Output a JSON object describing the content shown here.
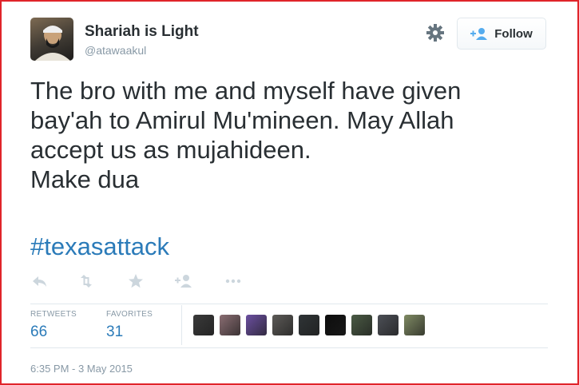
{
  "user": {
    "display_name": "Shariah is Light",
    "handle": "@atawaakul"
  },
  "header": {
    "follow_label": "Follow"
  },
  "tweet": {
    "text": "The bro with me and myself have given\nbay'ah to Amirul Mu'mineen. May Allah\naccept us as mujahideen.\nMake dua",
    "hashtag": "#texasattack"
  },
  "actions": [
    {
      "name": "reply-icon"
    },
    {
      "name": "retweet-icon"
    },
    {
      "name": "favorite-star-icon"
    },
    {
      "name": "follow-plus-icon"
    },
    {
      "name": "more-ellipsis-icon"
    }
  ],
  "stats": {
    "retweets_label": "RETWEETS",
    "retweets_count": "66",
    "favorites_label": "FAVORITES",
    "favorites_count": "31"
  },
  "favoriters": [
    "#3a3a3a",
    "#8a6d72",
    "#6b4fa0",
    "#5c5a57",
    "#2f3436",
    "#0d0d0d",
    "#4a5a44",
    "#4c4f56",
    "#7f8a63"
  ],
  "timestamp": "6:35 PM - 3 May 2015",
  "colors": {
    "link": "#2b7bb9",
    "text": "#292f33",
    "muted": "#8899a6",
    "frame_border": "#e0242a"
  }
}
